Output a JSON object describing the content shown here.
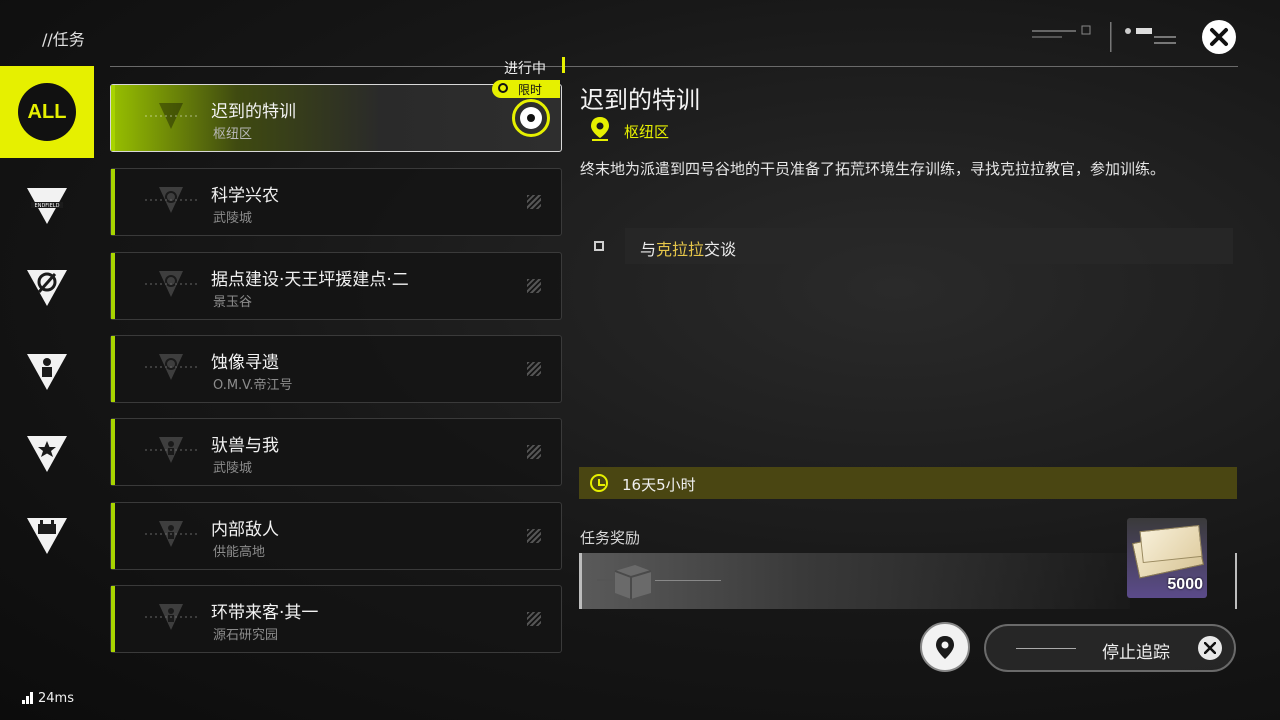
{
  "header": {
    "title": "//任务",
    "status_label": "进行中"
  },
  "rail": {
    "all_label": "ALL",
    "items": [
      {
        "icon": "all-icon",
        "selected": true
      },
      {
        "icon": "endfield-icon"
      },
      {
        "icon": "compass-icon"
      },
      {
        "icon": "person-icon"
      },
      {
        "icon": "star-icon"
      },
      {
        "icon": "event-icon"
      }
    ]
  },
  "quests": [
    {
      "name": "迟到的特训",
      "location": "枢纽区",
      "active": true,
      "limited": true
    },
    {
      "name": "科学兴农",
      "location": "武陵城"
    },
    {
      "name": "据点建设·天王坪援建点·二",
      "location": "景玉谷"
    },
    {
      "name": "蚀像寻遗",
      "location": "O.M.V.帝江号"
    },
    {
      "name": "驮兽与我",
      "location": "武陵城"
    },
    {
      "name": "内部敌人",
      "location": "供能高地"
    },
    {
      "name": "环带来客·其一",
      "location": "源石研究园"
    }
  ],
  "limited_tag": "限时",
  "detail": {
    "title": "迟到的特训",
    "region": "枢纽区",
    "description": "终末地为派遣到四号谷地的干员准备了拓荒环境生存训练，寻找克拉拉教官，参加训练。",
    "objective_prefix": "与",
    "objective_highlight": "克拉拉",
    "objective_suffix": "交谈",
    "timer": "16天5小时",
    "reward_label": "任务奖励",
    "reward_qty": "5000"
  },
  "controls": {
    "stop_tracking": "停止追踪"
  },
  "ping": "24ms",
  "colors": {
    "accent": "#e6f000",
    "list_accent": "#a8d400",
    "highlight_text": "#e6c64a"
  }
}
